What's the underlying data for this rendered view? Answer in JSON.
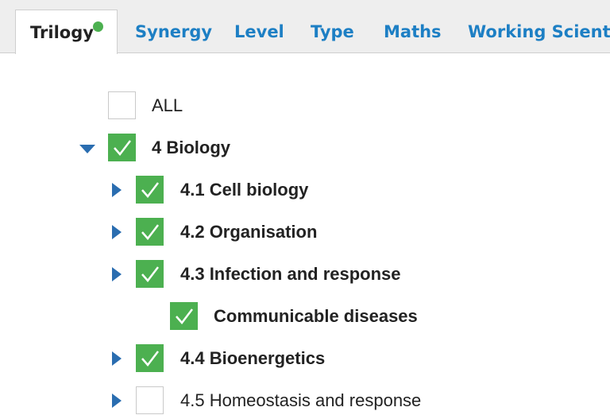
{
  "tabs": {
    "trilogy": "Trilogy",
    "synergy": "Synergy",
    "level": "Level",
    "type": "Type",
    "maths": "Maths",
    "working_scientifically": "Working Scientifi"
  },
  "tree": {
    "all": "ALL",
    "biology": "4 Biology",
    "cell_biology": "4.1 Cell biology",
    "organisation": "4.2 Organisation",
    "infection": "4.3 Infection and response",
    "communicable": "Communicable diseases",
    "bioenergetics": "4.4 Bioenergetics",
    "homeostasis": "4.5 Homeostasis and response"
  },
  "colors": {
    "accent": "#1d7fc4",
    "checked": "#4cb050",
    "expander": "#2a6db0",
    "active_dot": "#4cb050"
  },
  "icons": {
    "check": "check-icon",
    "expand": "caret-right-icon",
    "collapse": "caret-down-icon",
    "status": "status-dot-icon"
  }
}
